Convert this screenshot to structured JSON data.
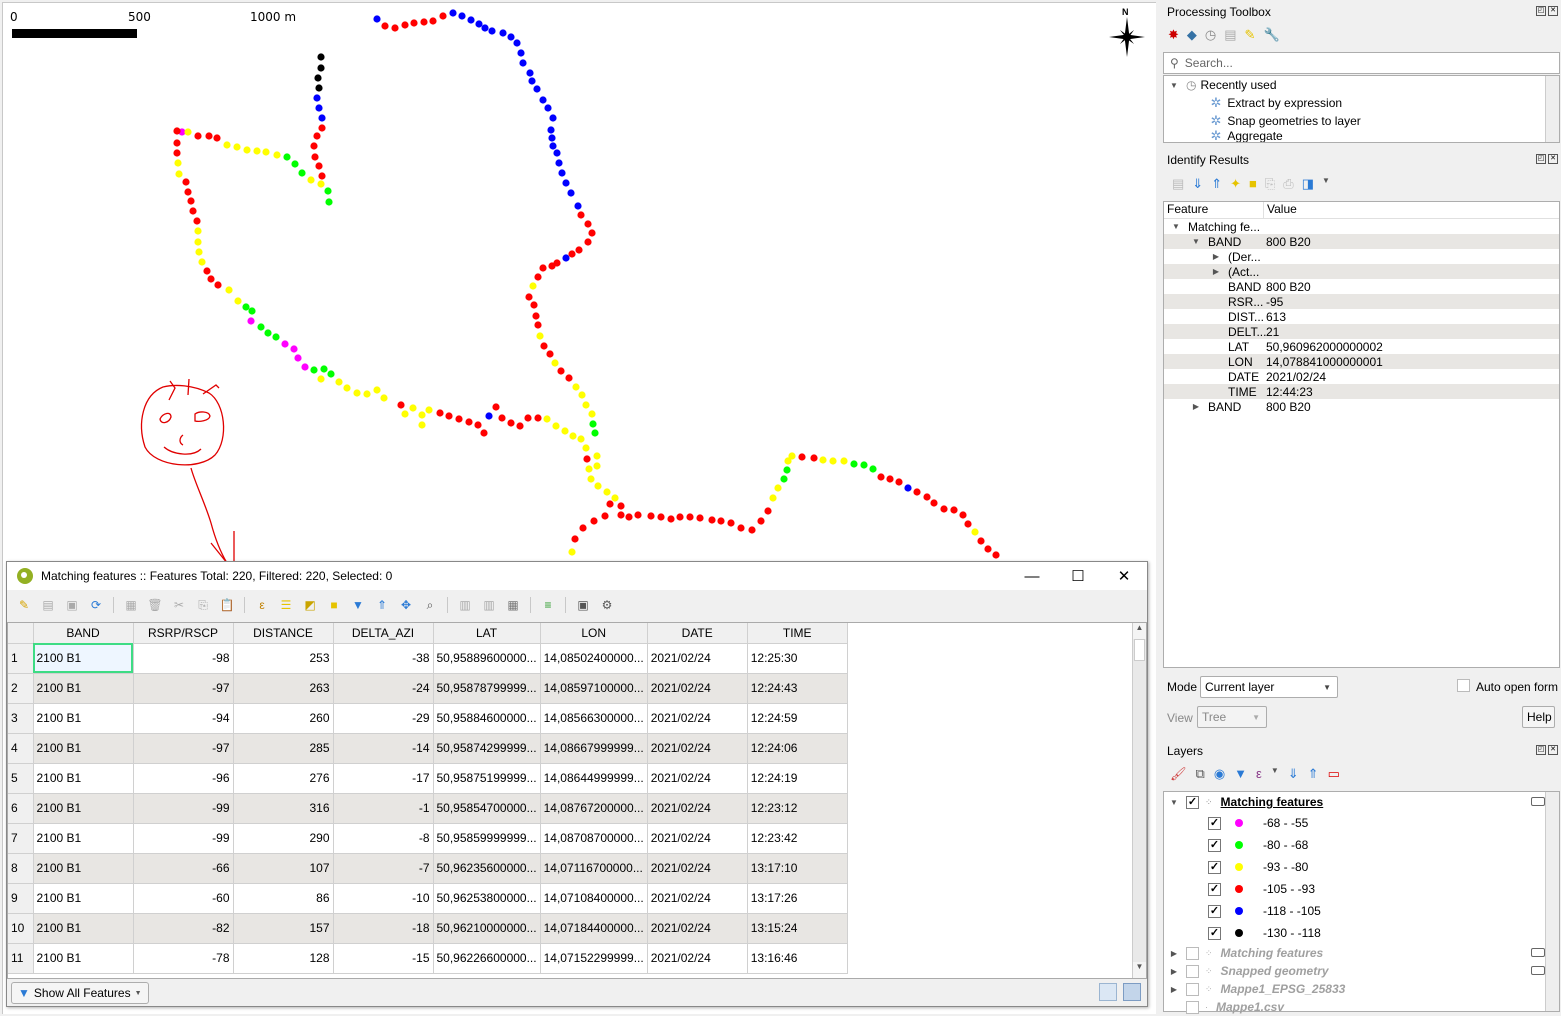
{
  "map": {
    "scalebar": {
      "labels": [
        "0",
        "500",
        "1000 m"
      ]
    },
    "north_label": "N",
    "annotation": "hand-drawn smiley face with arrow pointing to attribute table title",
    "legend_colors": {
      "magenta": "#ff00ff",
      "green": "#00ff00",
      "yellow": "#ffff00",
      "red": "#ff0000",
      "blue": "#0000ff",
      "black": "#000000"
    },
    "track_points": [
      [
        "m",
        181,
        131
      ],
      [
        "r",
        176,
        130
      ],
      [
        "r",
        176,
        142
      ],
      [
        "r",
        176,
        152
      ],
      [
        "y",
        177,
        162
      ],
      [
        "y",
        178,
        173
      ],
      [
        "r",
        185,
        181
      ],
      [
        "r",
        187,
        191
      ],
      [
        "r",
        190,
        200
      ],
      [
        "r",
        192,
        210
      ],
      [
        "r",
        196,
        220
      ],
      [
        "y",
        197,
        230
      ],
      [
        "y",
        197,
        241
      ],
      [
        "y",
        198,
        251
      ],
      [
        "y",
        201,
        261
      ],
      [
        "r",
        206,
        270
      ],
      [
        "r",
        210,
        278
      ],
      [
        "r",
        217,
        284
      ],
      [
        "y",
        228,
        289
      ],
      [
        "y",
        237,
        300
      ],
      [
        "g",
        245,
        306
      ],
      [
        "g",
        251,
        310
      ],
      [
        "m",
        250,
        320
      ],
      [
        "g",
        260,
        326
      ],
      [
        "g",
        267,
        332
      ],
      [
        "g",
        275,
        336
      ],
      [
        "m",
        284,
        343
      ],
      [
        "m",
        293,
        348
      ],
      [
        "m",
        297,
        357
      ],
      [
        "m",
        304,
        366
      ],
      [
        "g",
        313,
        369
      ],
      [
        "g",
        323,
        368
      ],
      [
        "g",
        330,
        373
      ],
      [
        "y",
        320,
        378
      ],
      [
        "y",
        338,
        381
      ],
      [
        "y",
        346,
        387
      ],
      [
        "y",
        356,
        392
      ],
      [
        "y",
        366,
        393
      ],
      [
        "y",
        376,
        389
      ],
      [
        "y",
        383,
        397
      ],
      [
        "r",
        400,
        404
      ],
      [
        "y",
        404,
        413
      ],
      [
        "y",
        412,
        407
      ],
      [
        "y",
        421,
        414
      ],
      [
        "y",
        421,
        424
      ],
      [
        "y",
        428,
        409
      ],
      [
        "r",
        439,
        412
      ],
      [
        "r",
        448,
        415
      ],
      [
        "r",
        458,
        418
      ],
      [
        "r",
        468,
        421
      ],
      [
        "r",
        477,
        424
      ],
      [
        "r",
        483,
        432
      ],
      [
        "b",
        488,
        415
      ],
      [
        "r",
        495,
        406
      ],
      [
        "r",
        501,
        417
      ],
      [
        "r",
        510,
        422
      ],
      [
        "r",
        519,
        425
      ],
      [
        "r",
        527,
        417
      ],
      [
        "r",
        537,
        417
      ],
      [
        "y",
        546,
        418
      ],
      [
        "y",
        555,
        425
      ],
      [
        "y",
        564,
        430
      ],
      [
        "y",
        572,
        435
      ],
      [
        "y",
        580,
        438
      ],
      [
        "y",
        585,
        447
      ],
      [
        "r",
        586,
        458
      ],
      [
        "y",
        588,
        468
      ],
      [
        "y",
        590,
        478
      ],
      [
        "y",
        597,
        485
      ],
      [
        "y",
        606,
        491
      ],
      [
        "y",
        614,
        497
      ],
      [
        "r",
        620,
        505
      ],
      [
        "r",
        620,
        514
      ],
      [
        "r",
        628,
        516
      ],
      [
        "r",
        637,
        514
      ],
      [
        "r",
        650,
        515
      ],
      [
        "r",
        660,
        516
      ],
      [
        "r",
        670,
        518
      ],
      [
        "r",
        679,
        516
      ],
      [
        "r",
        689,
        516
      ],
      [
        "r",
        699,
        517
      ],
      [
        "r",
        711,
        519
      ],
      [
        "r",
        720,
        520
      ],
      [
        "r",
        730,
        522
      ],
      [
        "r",
        740,
        527
      ],
      [
        "r",
        751,
        529
      ],
      [
        "r",
        760,
        520
      ],
      [
        "r",
        767,
        510
      ],
      [
        "y",
        772,
        497
      ],
      [
        "y",
        777,
        487
      ],
      [
        "g",
        783,
        478
      ],
      [
        "g",
        786,
        469
      ],
      [
        "y",
        787,
        460
      ],
      [
        "y",
        791,
        455
      ],
      [
        "r",
        801,
        456
      ],
      [
        "r",
        813,
        457
      ],
      [
        "y",
        822,
        459
      ],
      [
        "y",
        832,
        460
      ],
      [
        "y",
        843,
        460
      ],
      [
        "g",
        853,
        463
      ],
      [
        "g",
        863,
        464
      ],
      [
        "g",
        872,
        468
      ],
      [
        "r",
        880,
        476
      ],
      [
        "r",
        889,
        478
      ],
      [
        "r",
        898,
        481
      ],
      [
        "b",
        907,
        487
      ],
      [
        "r",
        916,
        491
      ],
      [
        "r",
        926,
        496
      ],
      [
        "r",
        933,
        502
      ],
      [
        "r",
        943,
        508
      ],
      [
        "r",
        953,
        509
      ],
      [
        "r",
        962,
        514
      ],
      [
        "r",
        967,
        523
      ],
      [
        "y",
        974,
        531
      ],
      [
        "r",
        980,
        540
      ],
      [
        "r",
        987,
        548
      ],
      [
        "r",
        995,
        554
      ],
      [
        "r",
        609,
        503
      ],
      [
        "r",
        604,
        515
      ],
      [
        "r",
        593,
        520
      ],
      [
        "r",
        582,
        527
      ],
      [
        "r",
        574,
        538
      ],
      [
        "y",
        571,
        551
      ],
      [
        "y",
        596,
        465
      ],
      [
        "y",
        596,
        455
      ],
      [
        "g",
        594,
        432
      ],
      [
        "g",
        592,
        423
      ],
      [
        "y",
        591,
        413
      ],
      [
        "y",
        585,
        404
      ],
      [
        "y",
        581,
        394
      ],
      [
        "y",
        575,
        386
      ],
      [
        "r",
        568,
        377
      ],
      [
        "r",
        560,
        370
      ],
      [
        "y",
        554,
        362
      ],
      [
        "r",
        549,
        353
      ],
      [
        "r",
        543,
        345
      ],
      [
        "y",
        539,
        335
      ],
      [
        "r",
        537,
        324
      ],
      [
        "r",
        535,
        315
      ],
      [
        "r",
        533,
        304
      ],
      [
        "r",
        528,
        296
      ],
      [
        "y",
        532,
        285
      ],
      [
        "r",
        537,
        276
      ],
      [
        "r",
        542,
        267
      ],
      [
        "r",
        551,
        265
      ],
      [
        "r",
        556,
        262
      ],
      [
        "b",
        565,
        257
      ],
      [
        "r",
        571,
        253
      ],
      [
        "r",
        578,
        249
      ],
      [
        "r",
        587,
        241
      ],
      [
        "r",
        591,
        232
      ],
      [
        "r",
        587,
        223
      ],
      [
        "r",
        580,
        214
      ],
      [
        "b",
        577,
        205
      ],
      [
        "b",
        570,
        192
      ],
      [
        "b",
        565,
        182
      ],
      [
        "b",
        561,
        172
      ],
      [
        "b",
        558,
        162
      ],
      [
        "b",
        556,
        152
      ],
      [
        "b",
        552,
        145
      ],
      [
        "b",
        551,
        137
      ],
      [
        "b",
        550,
        129
      ],
      [
        "b",
        552,
        117
      ],
      [
        "b",
        547,
        107
      ],
      [
        "b",
        542,
        99
      ],
      [
        "b",
        536,
        88
      ],
      [
        "b",
        531,
        80
      ],
      [
        "b",
        529,
        72
      ],
      [
        "b",
        522,
        62
      ],
      [
        "b",
        520,
        52
      ],
      [
        "b",
        516,
        42
      ],
      [
        "b",
        510,
        36
      ],
      [
        "b",
        502,
        32
      ],
      [
        "b",
        491,
        30
      ],
      [
        "b",
        484,
        27
      ],
      [
        "b",
        478,
        23
      ],
      [
        "b",
        470,
        19
      ],
      [
        "b",
        461,
        15
      ],
      [
        "b",
        452,
        12
      ],
      [
        "r",
        442,
        15
      ],
      [
        "r",
        432,
        20
      ],
      [
        "r",
        423,
        21
      ],
      [
        "r",
        413,
        22
      ],
      [
        "r",
        404,
        24
      ],
      [
        "r",
        394,
        27
      ],
      [
        "r",
        384,
        25
      ],
      [
        "b",
        376,
        18
      ],
      [
        "k",
        320,
        56
      ],
      [
        "k",
        320,
        67
      ],
      [
        "k",
        317,
        77
      ],
      [
        "k",
        318,
        87
      ],
      [
        "b",
        316,
        97
      ],
      [
        "b",
        318,
        107
      ],
      [
        "b",
        321,
        117
      ],
      [
        "r",
        321,
        127
      ],
      [
        "r",
        316,
        135
      ],
      [
        "r",
        313,
        145
      ],
      [
        "r",
        314,
        156
      ],
      [
        "r",
        318,
        165
      ],
      [
        "r",
        321,
        175
      ],
      [
        "g",
        327,
        190
      ],
      [
        "g",
        328,
        201
      ],
      [
        "y",
        320,
        183
      ],
      [
        "y",
        310,
        179
      ],
      [
        "g",
        301,
        172
      ],
      [
        "g",
        294,
        163
      ],
      [
        "g",
        286,
        156
      ],
      [
        "y",
        276,
        154
      ],
      [
        "y",
        265,
        151
      ],
      [
        "y",
        256,
        150
      ],
      [
        "y",
        246,
        149
      ],
      [
        "y",
        236,
        146
      ],
      [
        "y",
        226,
        144
      ],
      [
        "r",
        216,
        137
      ],
      [
        "r",
        208,
        135
      ],
      [
        "r",
        197,
        135
      ],
      [
        "y",
        187,
        131
      ]
    ]
  },
  "attribute_table": {
    "title": "Matching features :: Features Total: 220, Filtered: 220, Selected: 0",
    "window_controls": {
      "minimize": "—",
      "maximize": "☐",
      "close": "✕"
    },
    "columns": [
      "BAND",
      "RSRP/RSCP",
      "DISTANCE",
      "DELTA_AZI",
      "LAT",
      "LON",
      "DATE",
      "TIME"
    ],
    "rows": [
      [
        "1",
        "2100 B1",
        "-98",
        "253",
        "-38",
        "50,95889600000...",
        "14,08502400000...",
        "2021/02/24",
        "12:25:30"
      ],
      [
        "2",
        "2100 B1",
        "-97",
        "263",
        "-24",
        "50,95878799999...",
        "14,08597100000...",
        "2021/02/24",
        "12:24:43"
      ],
      [
        "3",
        "2100 B1",
        "-94",
        "260",
        "-29",
        "50,95884600000...",
        "14,08566300000...",
        "2021/02/24",
        "12:24:59"
      ],
      [
        "4",
        "2100 B1",
        "-97",
        "285",
        "-14",
        "50,95874299999...",
        "14,08667999999...",
        "2021/02/24",
        "12:24:06"
      ],
      [
        "5",
        "2100 B1",
        "-96",
        "276",
        "-17",
        "50,95875199999...",
        "14,08644999999...",
        "2021/02/24",
        "12:24:19"
      ],
      [
        "6",
        "2100 B1",
        "-99",
        "316",
        "-1",
        "50,95854700000...",
        "14,08767200000...",
        "2021/02/24",
        "12:23:12"
      ],
      [
        "7",
        "2100 B1",
        "-99",
        "290",
        "-8",
        "50,95859999999...",
        "14,08708700000...",
        "2021/02/24",
        "12:23:42"
      ],
      [
        "8",
        "2100 B1",
        "-66",
        "107",
        "-7",
        "50,96235600000...",
        "14,07116700000...",
        "2021/02/24",
        "13:17:10"
      ],
      [
        "9",
        "2100 B1",
        "-60",
        "86",
        "-10",
        "50,96253800000...",
        "14,07108400000...",
        "2021/02/24",
        "13:17:26"
      ],
      [
        "10",
        "2100 B1",
        "-82",
        "157",
        "-18",
        "50,96210000000...",
        "14,07184400000...",
        "2021/02/24",
        "13:15:24"
      ],
      [
        "11",
        "2100 B1",
        "-78",
        "128",
        "-15",
        "50,96226600000...",
        "14,07152299999...",
        "2021/02/24",
        "13:16:46"
      ]
    ],
    "footer": {
      "filter_button": "Show All Features"
    }
  },
  "processing_toolbox": {
    "title": "Processing Toolbox",
    "search_placeholder": "Search...",
    "recent_group": "Recently used",
    "items": [
      "Extract by expression",
      "Snap geometries to layer",
      "Aggregate"
    ]
  },
  "identify_results": {
    "title": "Identify Results",
    "headers": {
      "feature": "Feature",
      "value": "Value"
    },
    "tree": [
      {
        "level": 0,
        "arrow": "down",
        "feature": "Matching fe...",
        "value": ""
      },
      {
        "level": 1,
        "arrow": "down",
        "feature": "BAND",
        "value": "800 B20"
      },
      {
        "level": 2,
        "arrow": "right",
        "feature": "(Der...",
        "value": ""
      },
      {
        "level": 2,
        "arrow": "right",
        "feature": "(Act...",
        "value": ""
      },
      {
        "level": 2,
        "arrow": "",
        "feature": "BAND",
        "value": "800 B20"
      },
      {
        "level": 2,
        "arrow": "",
        "feature": "RSR...",
        "value": "-95"
      },
      {
        "level": 2,
        "arrow": "",
        "feature": "DIST...",
        "value": "613"
      },
      {
        "level": 2,
        "arrow": "",
        "feature": "DELT...",
        "value": "21"
      },
      {
        "level": 2,
        "arrow": "",
        "feature": "LAT",
        "value": "50,960962000000002"
      },
      {
        "level": 2,
        "arrow": "",
        "feature": "LON",
        "value": "14,078841000000001"
      },
      {
        "level": 2,
        "arrow": "",
        "feature": "DATE",
        "value": "2021/02/24"
      },
      {
        "level": 2,
        "arrow": "",
        "feature": "TIME",
        "value": "12:44:23"
      },
      {
        "level": 1,
        "arrow": "right",
        "feature": "BAND",
        "value": "800 B20"
      }
    ],
    "mode_label": "Mode",
    "mode_value": "Current layer",
    "auto_open_form": "Auto open form",
    "view_label": "View",
    "view_value": "Tree",
    "help": "Help"
  },
  "layers": {
    "title": "Layers",
    "active_layer": "Matching features",
    "classes": [
      {
        "label": "-68 - -55",
        "color": "#ff00ff"
      },
      {
        "label": "-80 - -68",
        "color": "#00ff00"
      },
      {
        "label": "-93 - -80",
        "color": "#ffff00"
      },
      {
        "label": "-105 - -93",
        "color": "#ff0000"
      },
      {
        "label": "-118 - -105",
        "color": "#0000ff"
      },
      {
        "label": "-130 - -118",
        "color": "#000000"
      }
    ],
    "other_layers": [
      "Matching features",
      "Snapped geometry",
      "Mappe1_EPSG_25833",
      "Mappe1.csv"
    ]
  }
}
